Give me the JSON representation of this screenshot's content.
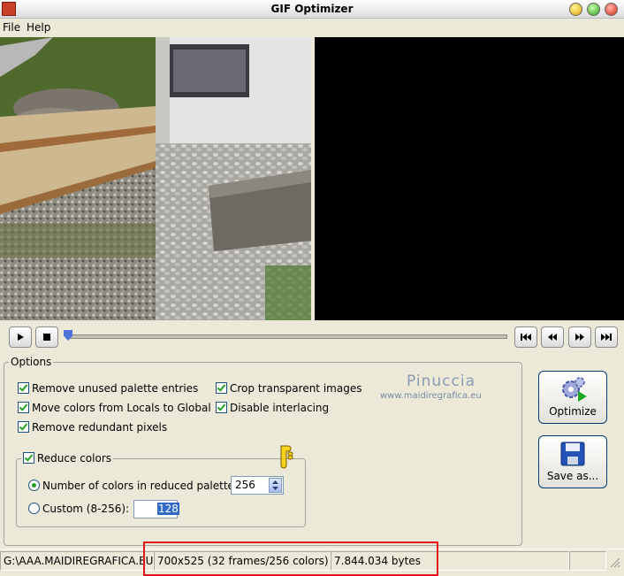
{
  "window": {
    "title": "GIF Optimizer"
  },
  "menu": {
    "file": "File",
    "help": "Help"
  },
  "watermark": {
    "name": "Pinuccia",
    "url": "www.maidiregrafica.eu"
  },
  "options": {
    "legend": "Options",
    "remove_unused": {
      "label": "Remove unused palette entries",
      "checked": true
    },
    "move_colors": {
      "label": "Move colors from Locals to Global",
      "checked": true
    },
    "remove_redundant": {
      "label": "Remove redundant pixels",
      "checked": true
    },
    "crop_transparent": {
      "label": "Crop transparent images",
      "checked": true
    },
    "disable_interlacing": {
      "label": "Disable interlacing",
      "checked": true
    },
    "reduce_colors": {
      "label": "Reduce colors",
      "checked": true,
      "number_label": "Number of colors in reduced palette:",
      "number_value": "256",
      "custom_label": "Custom (8-256):",
      "custom_value": "128"
    }
  },
  "buttons": {
    "optimize": "Optimize",
    "save_as": "Save as..."
  },
  "status": {
    "path": "G:\\AAA.MAIDIREGRAFICA.EU\\t",
    "dimensions": "700x525 (32 frames/256 colors)",
    "size": "7.844.034 bytes"
  },
  "colors": {
    "highlight": "#e3121b",
    "selection": "#316ac5",
    "accent_green": "#21a121"
  }
}
